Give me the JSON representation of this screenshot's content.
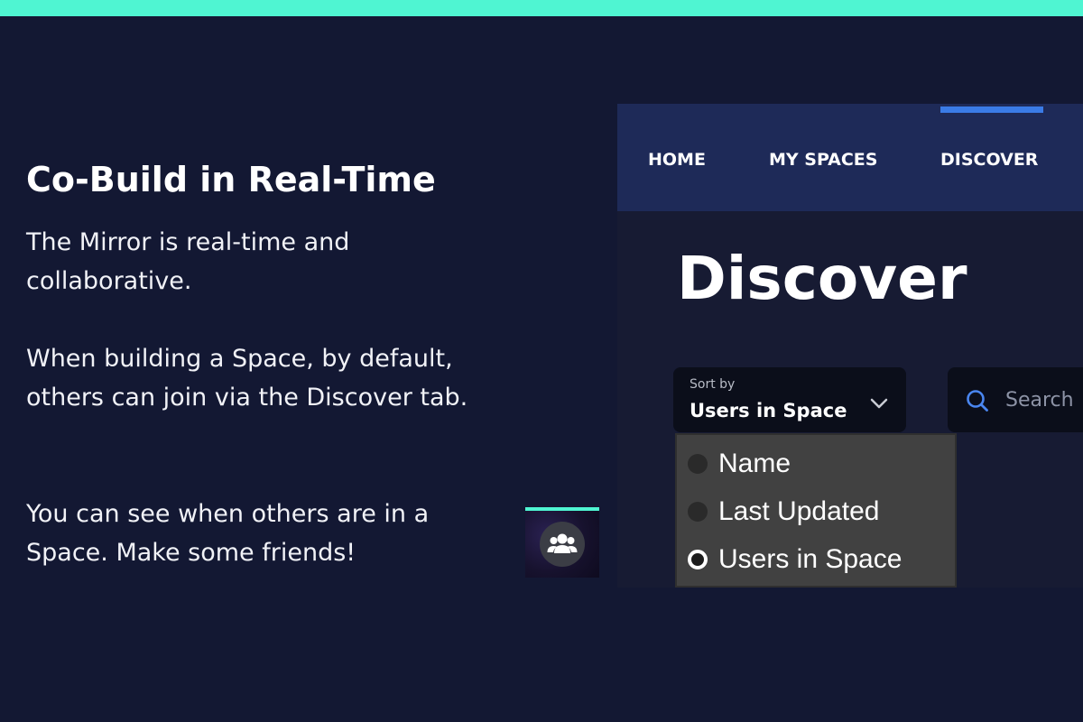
{
  "colors": {
    "background": "#131833",
    "accent": "#4ff5d2",
    "nav_active": "#3a7be6",
    "nav_background": "#1e2a58",
    "dropdown_background": "#414141"
  },
  "slide": {
    "heading": "Co-Build in Real-Time",
    "paragraphs": [
      "The Mirror is real-time and collaborative.",
      "When building a Space, by default, others can join via the Discover tab.",
      "You can see when others are in a Space. Make some friends!"
    ]
  },
  "thumbnail": {
    "icon": "users-group-icon"
  },
  "app": {
    "nav": {
      "items": [
        {
          "label": "HOME",
          "active": false
        },
        {
          "label": "MY SPACES",
          "active": false
        },
        {
          "label": "DISCOVER",
          "active": true
        }
      ]
    },
    "page_title": "Discover",
    "sort": {
      "label": "Sort by",
      "value": "Users in Space",
      "icon": "chevron-down-icon",
      "options": [
        {
          "label": "Name",
          "selected": false
        },
        {
          "label": "Last Updated",
          "selected": false
        },
        {
          "label": "Users in Space",
          "selected": true
        }
      ]
    },
    "search": {
      "placeholder": "Search",
      "icon": "search-icon"
    }
  }
}
